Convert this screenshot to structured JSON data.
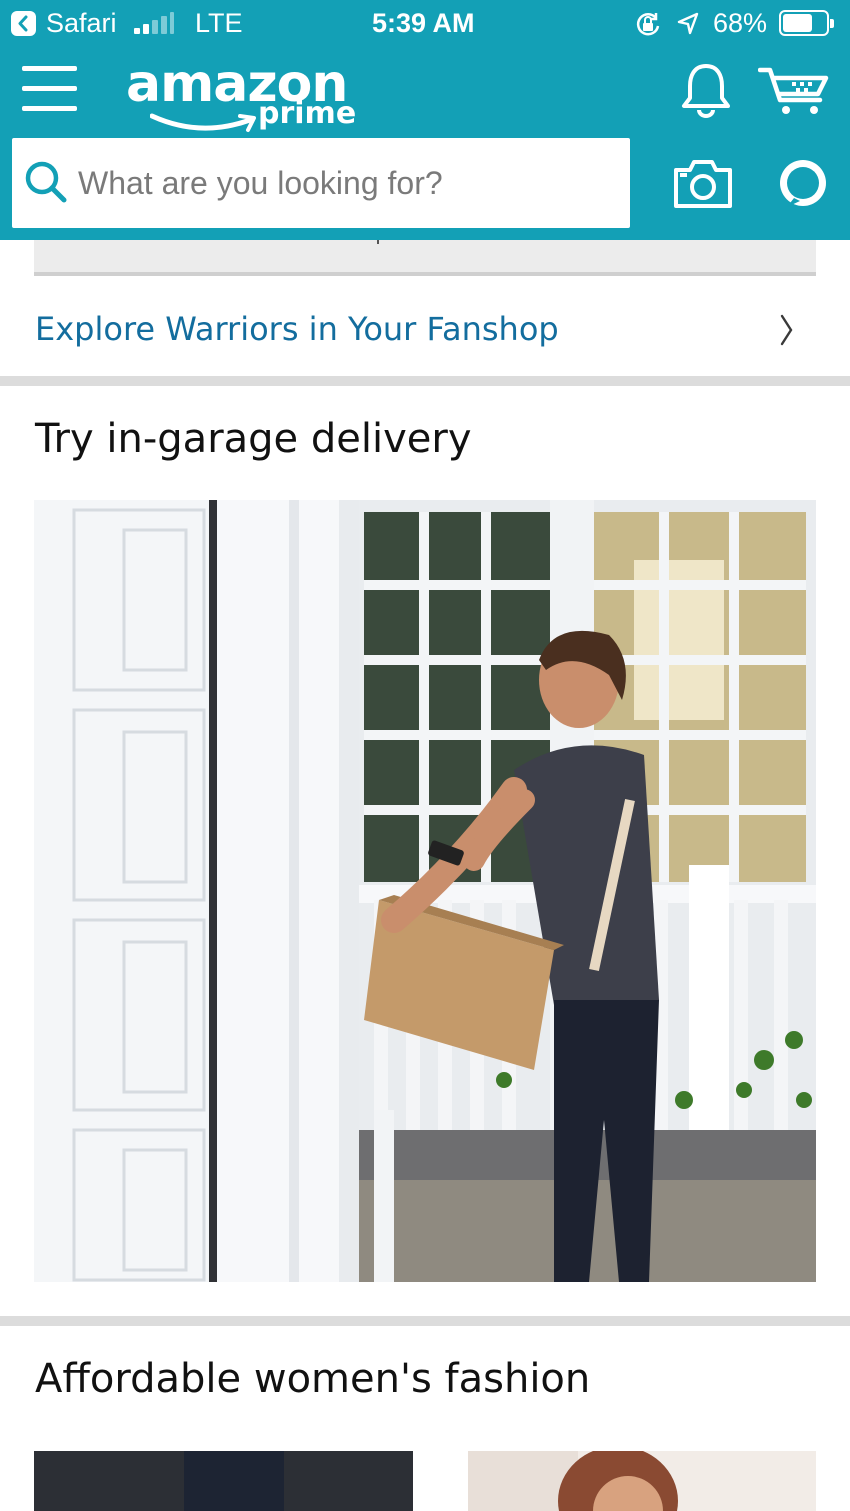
{
  "status_bar": {
    "back_app": "Safari",
    "network": "LTE",
    "time": "5:39 AM",
    "battery": "68%",
    "battery_level": 0.68,
    "signal_bars": 2
  },
  "header": {
    "logo_word": "amazon",
    "logo_sub": "prime",
    "background": "#13a0b6",
    "icons": [
      "menu-icon",
      "bell-icon",
      "cart-icon",
      "search-icon",
      "camera-icon",
      "alexa-icon"
    ]
  },
  "search": {
    "placeholder": "What are you looking for?",
    "value": ""
  },
  "fanshop": {
    "link_text": "Explore Warriors in Your Fanshop",
    "link_color": "#136d9e"
  },
  "sections": [
    {
      "title": "Try in-garage delivery"
    },
    {
      "title": "Affordable women's fashion"
    }
  ]
}
